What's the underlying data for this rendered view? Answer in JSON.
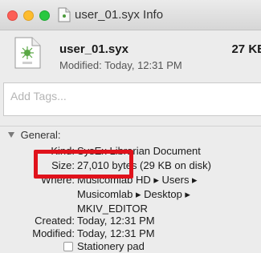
{
  "window": {
    "title": "user_01.syx Info"
  },
  "header": {
    "file_name": "user_01.syx",
    "file_size": "27 KB",
    "modified": "Modified: Today, 12:31 PM"
  },
  "tags": {
    "placeholder": "Add Tags..."
  },
  "general": {
    "heading": "General:",
    "rows": [
      {
        "label": "Kind:",
        "value": "SysEx Librarian Document"
      },
      {
        "label": "Size:",
        "value": "27,010 bytes (29 KB on disk)"
      },
      {
        "label": "Where:",
        "value": "Musicomlab HD ▸ Users ▸"
      },
      {
        "label": "",
        "value": "Musicomlab ▸ Desktop ▸"
      },
      {
        "label": "",
        "value": "MKIV_EDITOR"
      },
      {
        "label": "Created:",
        "value": "Today, 12:31 PM"
      },
      {
        "label": "Modified:",
        "value": "Today, 12:31 PM"
      }
    ],
    "stationery_label": "Stationery pad",
    "stationery_checked": false
  },
  "colors": {
    "highlight": "#e0121b",
    "close": "#fc5f57",
    "minimize": "#fdbc2e",
    "zoom": "#28c840"
  }
}
